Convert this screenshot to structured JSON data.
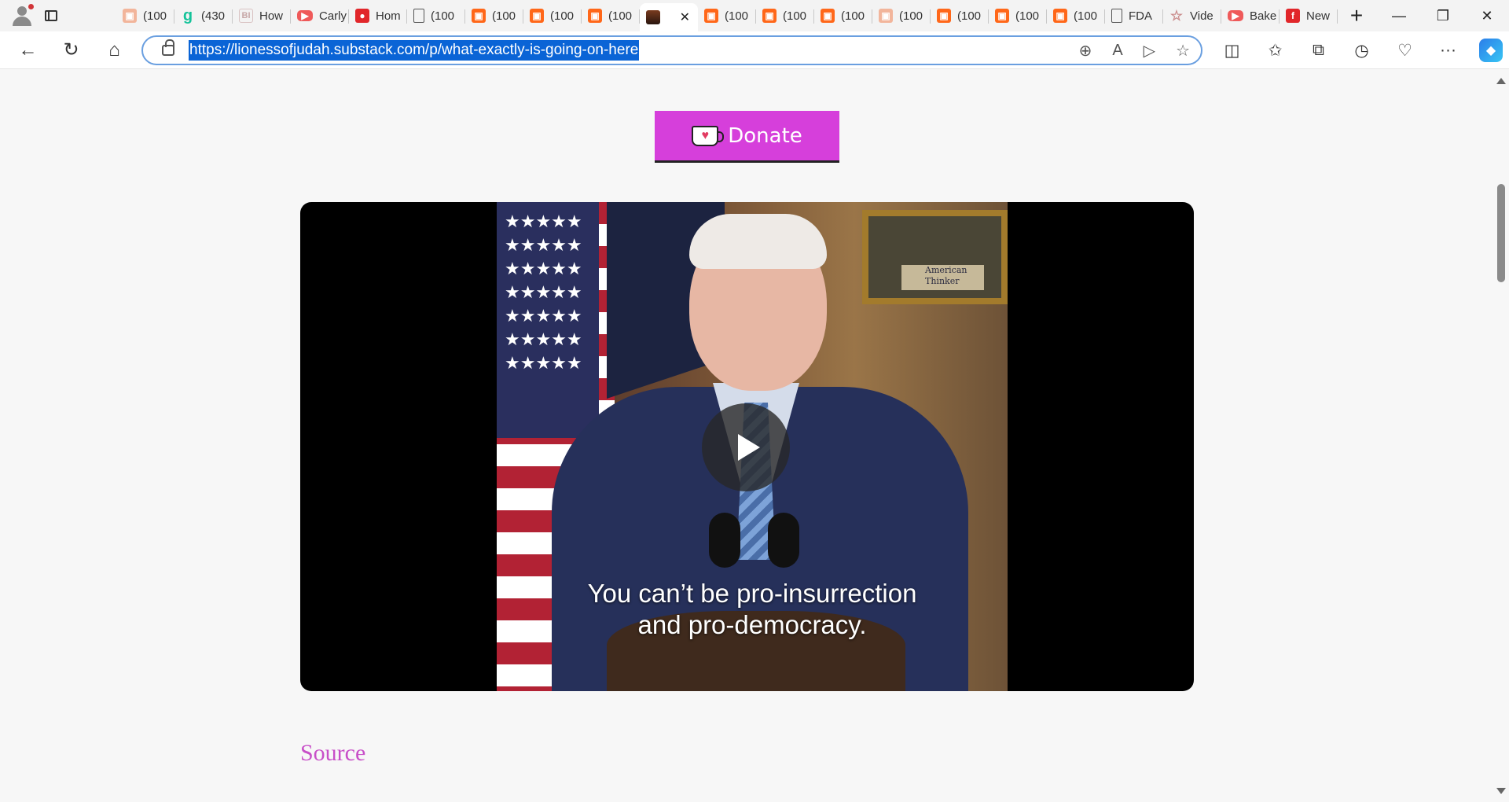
{
  "browser": {
    "tabs": [
      {
        "label": "(100",
        "icon": "substack-faded-icon"
      },
      {
        "label": "(430",
        "icon": "grammarly-icon"
      },
      {
        "label": "How",
        "icon": "bi-icon"
      },
      {
        "label": "Carly",
        "icon": "youtube-icon"
      },
      {
        "label": "Hom",
        "icon": "red-app-icon"
      },
      {
        "label": "(100",
        "icon": "document-icon"
      },
      {
        "label": "(100",
        "icon": "substack-icon"
      },
      {
        "label": "(100",
        "icon": "substack-icon"
      },
      {
        "label": "(100",
        "icon": "substack-icon"
      },
      {
        "label": "",
        "icon": "image-icon",
        "active": true
      },
      {
        "label": "(100",
        "icon": "substack-icon"
      },
      {
        "label": "(100",
        "icon": "substack-icon"
      },
      {
        "label": "(100",
        "icon": "substack-icon"
      },
      {
        "label": "(100",
        "icon": "substack-faded-icon"
      },
      {
        "label": "(100",
        "icon": "substack-icon"
      },
      {
        "label": "(100",
        "icon": "substack-icon"
      },
      {
        "label": "(100",
        "icon": "substack-icon"
      },
      {
        "label": "FDA",
        "icon": "document-icon"
      },
      {
        "label": "Vide",
        "icon": "star-icon"
      },
      {
        "label": "Bake",
        "icon": "youtube-icon"
      },
      {
        "label": "New",
        "icon": "flipboard-icon"
      }
    ],
    "url": "https://lionessofjudah.substack.com/p/what-exactly-is-going-on-here"
  },
  "page": {
    "donate_label": "Donate",
    "video": {
      "caption_line1": "You can’t be pro-insurrection",
      "caption_line2": "and pro-democracy.",
      "watermark_line1": "American",
      "watermark_line2": "Thinker"
    },
    "source_label": "Source"
  },
  "colors": {
    "donate": "#d63fdb",
    "source_link": "#c84fc8",
    "url_highlight": "#0a64d6"
  }
}
